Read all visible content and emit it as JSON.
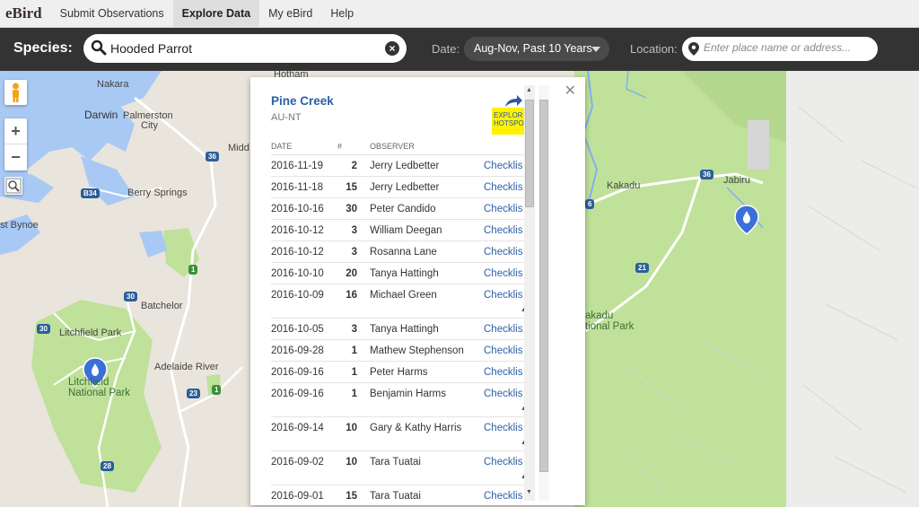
{
  "nav": {
    "logo": "eBird",
    "items": [
      {
        "label": "Submit Observations",
        "active": false
      },
      {
        "label": "Explore Data",
        "active": true
      },
      {
        "label": "My eBird",
        "active": false
      },
      {
        "label": "Help",
        "active": false
      }
    ]
  },
  "search": {
    "species_label": "Species:",
    "species_value": "Hooded Parrot",
    "date_label": "Date:",
    "date_value": "Aug-Nov, Past 10 Years",
    "location_label": "Location:",
    "location_placeholder": "Enter place name or address..."
  },
  "map": {
    "labels": {
      "nakara": "Nakara",
      "darwin": "Darwin",
      "palmerston": "Palmerston",
      "city": "City",
      "midd": "Midd",
      "hotham": "Hotham",
      "berry_springs": "Berry Springs",
      "bynoe": "st Bynoe",
      "batchelor": "Batchelor",
      "litchfield_park": "Litchfield Park",
      "adelaide_river": "Adelaide River",
      "litchfield_np_1": "Litchfield",
      "litchfield_np_2": "National Park",
      "kakadu": "Kakadu",
      "jabiru": "Jabiru",
      "kakadu_np_1": "akadu",
      "kakadu_np_2": "tional Park"
    },
    "shields": {
      "s36a": "36",
      "s36b": "36",
      "s34": "B34",
      "s1a": "1",
      "s30a": "30",
      "s30b": "30",
      "s23": "23",
      "s1b": "1",
      "s28": "28",
      "s21": "21",
      "s6": "6"
    },
    "colors": {
      "park": "#bfe19a",
      "water": "#a9c9f5",
      "land": "#e9e5dc",
      "hotspot": "#3b6fd9"
    }
  },
  "popup": {
    "title": "Pine Creek",
    "subtitle": "AU-NT",
    "explore_line1": "EXPLOR",
    "explore_line2": "HOTSPO",
    "columns": {
      "date": "DATE",
      "count": "#",
      "observer": "OBSERVER"
    },
    "rows": [
      {
        "date": "2016-11-19",
        "count": "2",
        "observer": "Jerry Ledbetter",
        "link": "Checklis"
      },
      {
        "date": "2016-11-18",
        "count": "15",
        "observer": "Jerry Ledbetter",
        "link": "Checklis"
      },
      {
        "date": "2016-10-16",
        "count": "30",
        "observer": "Peter Candido",
        "link": "Checklis"
      },
      {
        "date": "2016-10-12",
        "count": "3",
        "observer": "William Deegan",
        "link": "Checklis"
      },
      {
        "date": "2016-10-12",
        "count": "3",
        "observer": "Rosanna Lane",
        "link": "Checklis"
      },
      {
        "date": "2016-10-10",
        "count": "20",
        "observer": "Tanya Hattingh",
        "link": "Checklis"
      },
      {
        "date": "2016-10-09",
        "count": "16",
        "observer": "Michael Green",
        "link": "Checklis",
        "tall": true
      },
      {
        "date": "2016-10-05",
        "count": "3",
        "observer": "Tanya Hattingh",
        "link": "Checklis"
      },
      {
        "date": "2016-09-28",
        "count": "1",
        "observer": "Mathew Stephenson",
        "link": "Checklis"
      },
      {
        "date": "2016-09-16",
        "count": "1",
        "observer": "Peter Harms",
        "link": "Checklis"
      },
      {
        "date": "2016-09-16",
        "count": "1",
        "observer": "Benjamin Harms",
        "link": "Checklis",
        "tall": true
      },
      {
        "date": "2016-09-14",
        "count": "10",
        "observer": "Gary & Kathy Harris",
        "link": "Checklis",
        "tall": true
      },
      {
        "date": "2016-09-02",
        "count": "10",
        "observer": "Tara Tuatai",
        "link": "Checklis",
        "tall": true
      },
      {
        "date": "2016-09-01",
        "count": "15",
        "observer": "Tara Tuatai",
        "link": "Checklis"
      }
    ]
  }
}
